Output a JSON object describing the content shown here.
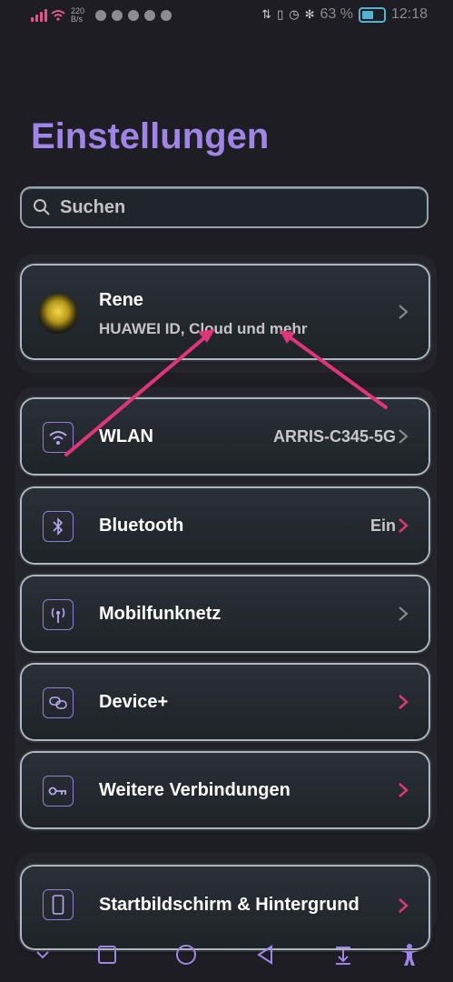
{
  "status_bar": {
    "speed_value": "220",
    "speed_unit": "B/s",
    "battery_percent": "63 %",
    "time": "12:18"
  },
  "title": "Einstellungen",
  "search": {
    "placeholder": "Suchen"
  },
  "profile": {
    "name": "Rene",
    "subtitle": "HUAWEI ID, Cloud und mehr"
  },
  "settings_items": [
    {
      "label": "WLAN",
      "value": "ARRIS-C345-5G",
      "icon": "wifi-icon"
    },
    {
      "label": "Bluetooth",
      "value": "Ein",
      "icon": "bluetooth-icon"
    },
    {
      "label": "Mobilfunknetz",
      "value": "",
      "icon": "antenna-icon"
    },
    {
      "label": "Device+",
      "value": "",
      "icon": "device-plus-icon"
    },
    {
      "label": "Weitere Verbindungen",
      "value": "",
      "icon": "key-icon"
    },
    {
      "label": "Startbildschirm & Hintergrund",
      "value": "",
      "icon": "phone-icon"
    }
  ],
  "colors": {
    "accent": "#9f85e6",
    "annotation_arrow": "#e0357a",
    "background": "#1d1d23"
  },
  "navbar_icons": [
    "chevron-down-icon",
    "recents-square-icon",
    "home-circle-icon",
    "back-triangle-icon",
    "pull-down-icon",
    "accessibility-icon"
  ]
}
